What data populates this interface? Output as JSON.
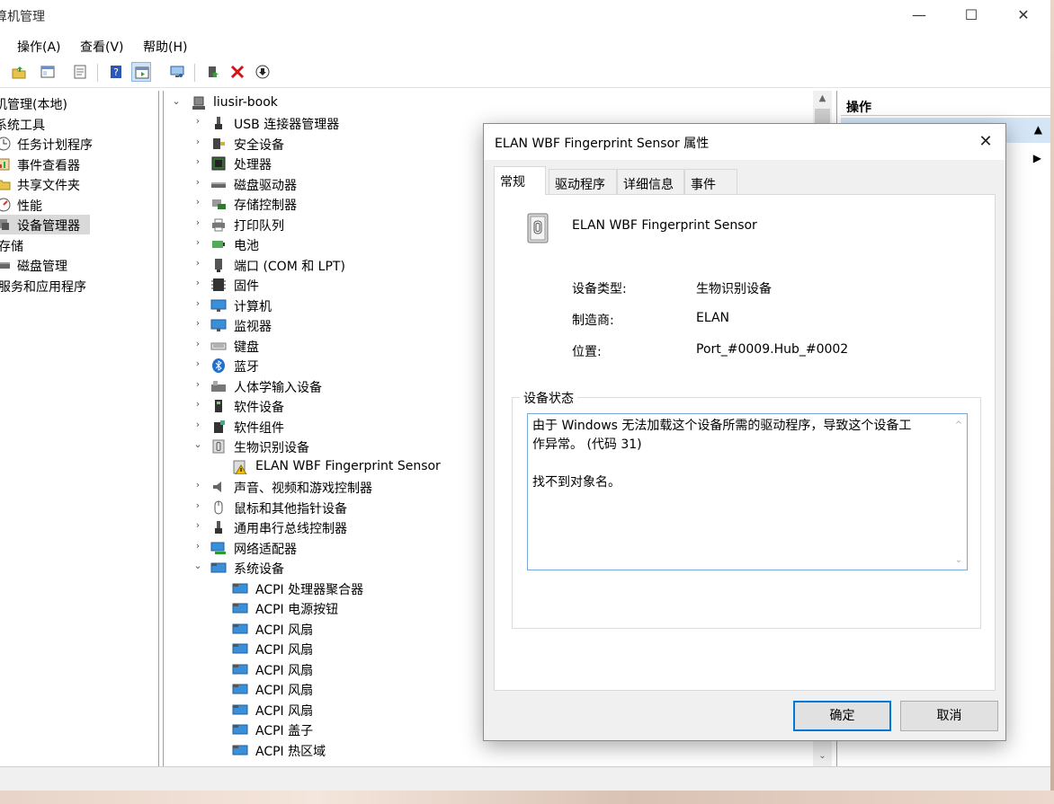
{
  "window": {
    "title": "算机管理",
    "controls": {
      "minimize": "—",
      "maximize": "☐",
      "close": "✕"
    }
  },
  "menu": [
    {
      "label": "操作(A)"
    },
    {
      "label": "查看(V)"
    },
    {
      "label": "帮助(H)"
    }
  ],
  "left_tree": {
    "items": [
      {
        "label": "机管理(本地)"
      },
      {
        "label": "系统工具"
      },
      {
        "label": "任务计划程序",
        "icon": "clock-icon"
      },
      {
        "label": "事件查看器",
        "icon": "event-viewer-icon"
      },
      {
        "label": "共享文件夹",
        "icon": "shared-folder-icon"
      },
      {
        "label": "性能",
        "icon": "performance-icon"
      },
      {
        "label": "设备管理器",
        "icon": "device-manager-icon"
      },
      {
        "label": "存储"
      },
      {
        "label": "磁盘管理",
        "icon": "disk-icon"
      },
      {
        "label": "服务和应用程序"
      }
    ]
  },
  "device_tree": {
    "root": "liusir-book",
    "categories": [
      {
        "label": "USB 连接器管理器"
      },
      {
        "label": "安全设备"
      },
      {
        "label": "处理器"
      },
      {
        "label": "磁盘驱动器"
      },
      {
        "label": "存储控制器"
      },
      {
        "label": "打印队列"
      },
      {
        "label": "电池"
      },
      {
        "label": "端口 (COM 和 LPT)"
      },
      {
        "label": "固件"
      },
      {
        "label": "计算机"
      },
      {
        "label": "监视器"
      },
      {
        "label": "键盘"
      },
      {
        "label": "蓝牙"
      },
      {
        "label": "人体学输入设备"
      },
      {
        "label": "软件设备"
      },
      {
        "label": "软件组件"
      },
      {
        "label": "生物识别设备"
      },
      {
        "label": "ELAN WBF Fingerprint Sensor"
      },
      {
        "label": "声音、视频和游戏控制器"
      },
      {
        "label": "鼠标和其他指针设备"
      },
      {
        "label": "通用串行总线控制器"
      },
      {
        "label": "网络适配器"
      },
      {
        "label": "系统设备"
      },
      {
        "label": "ACPI 处理器聚合器"
      },
      {
        "label": "ACPI 电源按钮"
      },
      {
        "label": "ACPI 风扇"
      },
      {
        "label": "ACPI 风扇"
      },
      {
        "label": "ACPI 风扇"
      },
      {
        "label": "ACPI 风扇"
      },
      {
        "label": "ACPI 风扇"
      },
      {
        "label": "ACPI 盖子"
      },
      {
        "label": "ACPI 热区域"
      }
    ]
  },
  "actions_pane": {
    "header": "操作"
  },
  "dialog": {
    "title": "ELAN WBF Fingerprint Sensor 属性",
    "tabs": [
      {
        "label": "常规"
      },
      {
        "label": "驱动程序"
      },
      {
        "label": "详细信息"
      },
      {
        "label": "事件"
      }
    ],
    "device_name": "ELAN WBF Fingerprint Sensor",
    "props": {
      "type_label": "设备类型:",
      "type_value": "生物识别设备",
      "mfr_label": "制造商:",
      "mfr_value": "ELAN",
      "loc_label": "位置:",
      "loc_value": "Port_#0009.Hub_#0002"
    },
    "status_group_label": "设备状态",
    "status_line1": "由于 Windows 无法加载这个设备所需的驱动程序，导致这个设备工",
    "status_line2": "作异常。 (代码 31)",
    "status_line3": "找不到对象名。",
    "ok_label": "确定",
    "cancel_label": "取消"
  },
  "colors": {
    "selection": "#d4e5f6",
    "accent": "#0078d7",
    "dialog_bg": "#f0f0f0"
  }
}
